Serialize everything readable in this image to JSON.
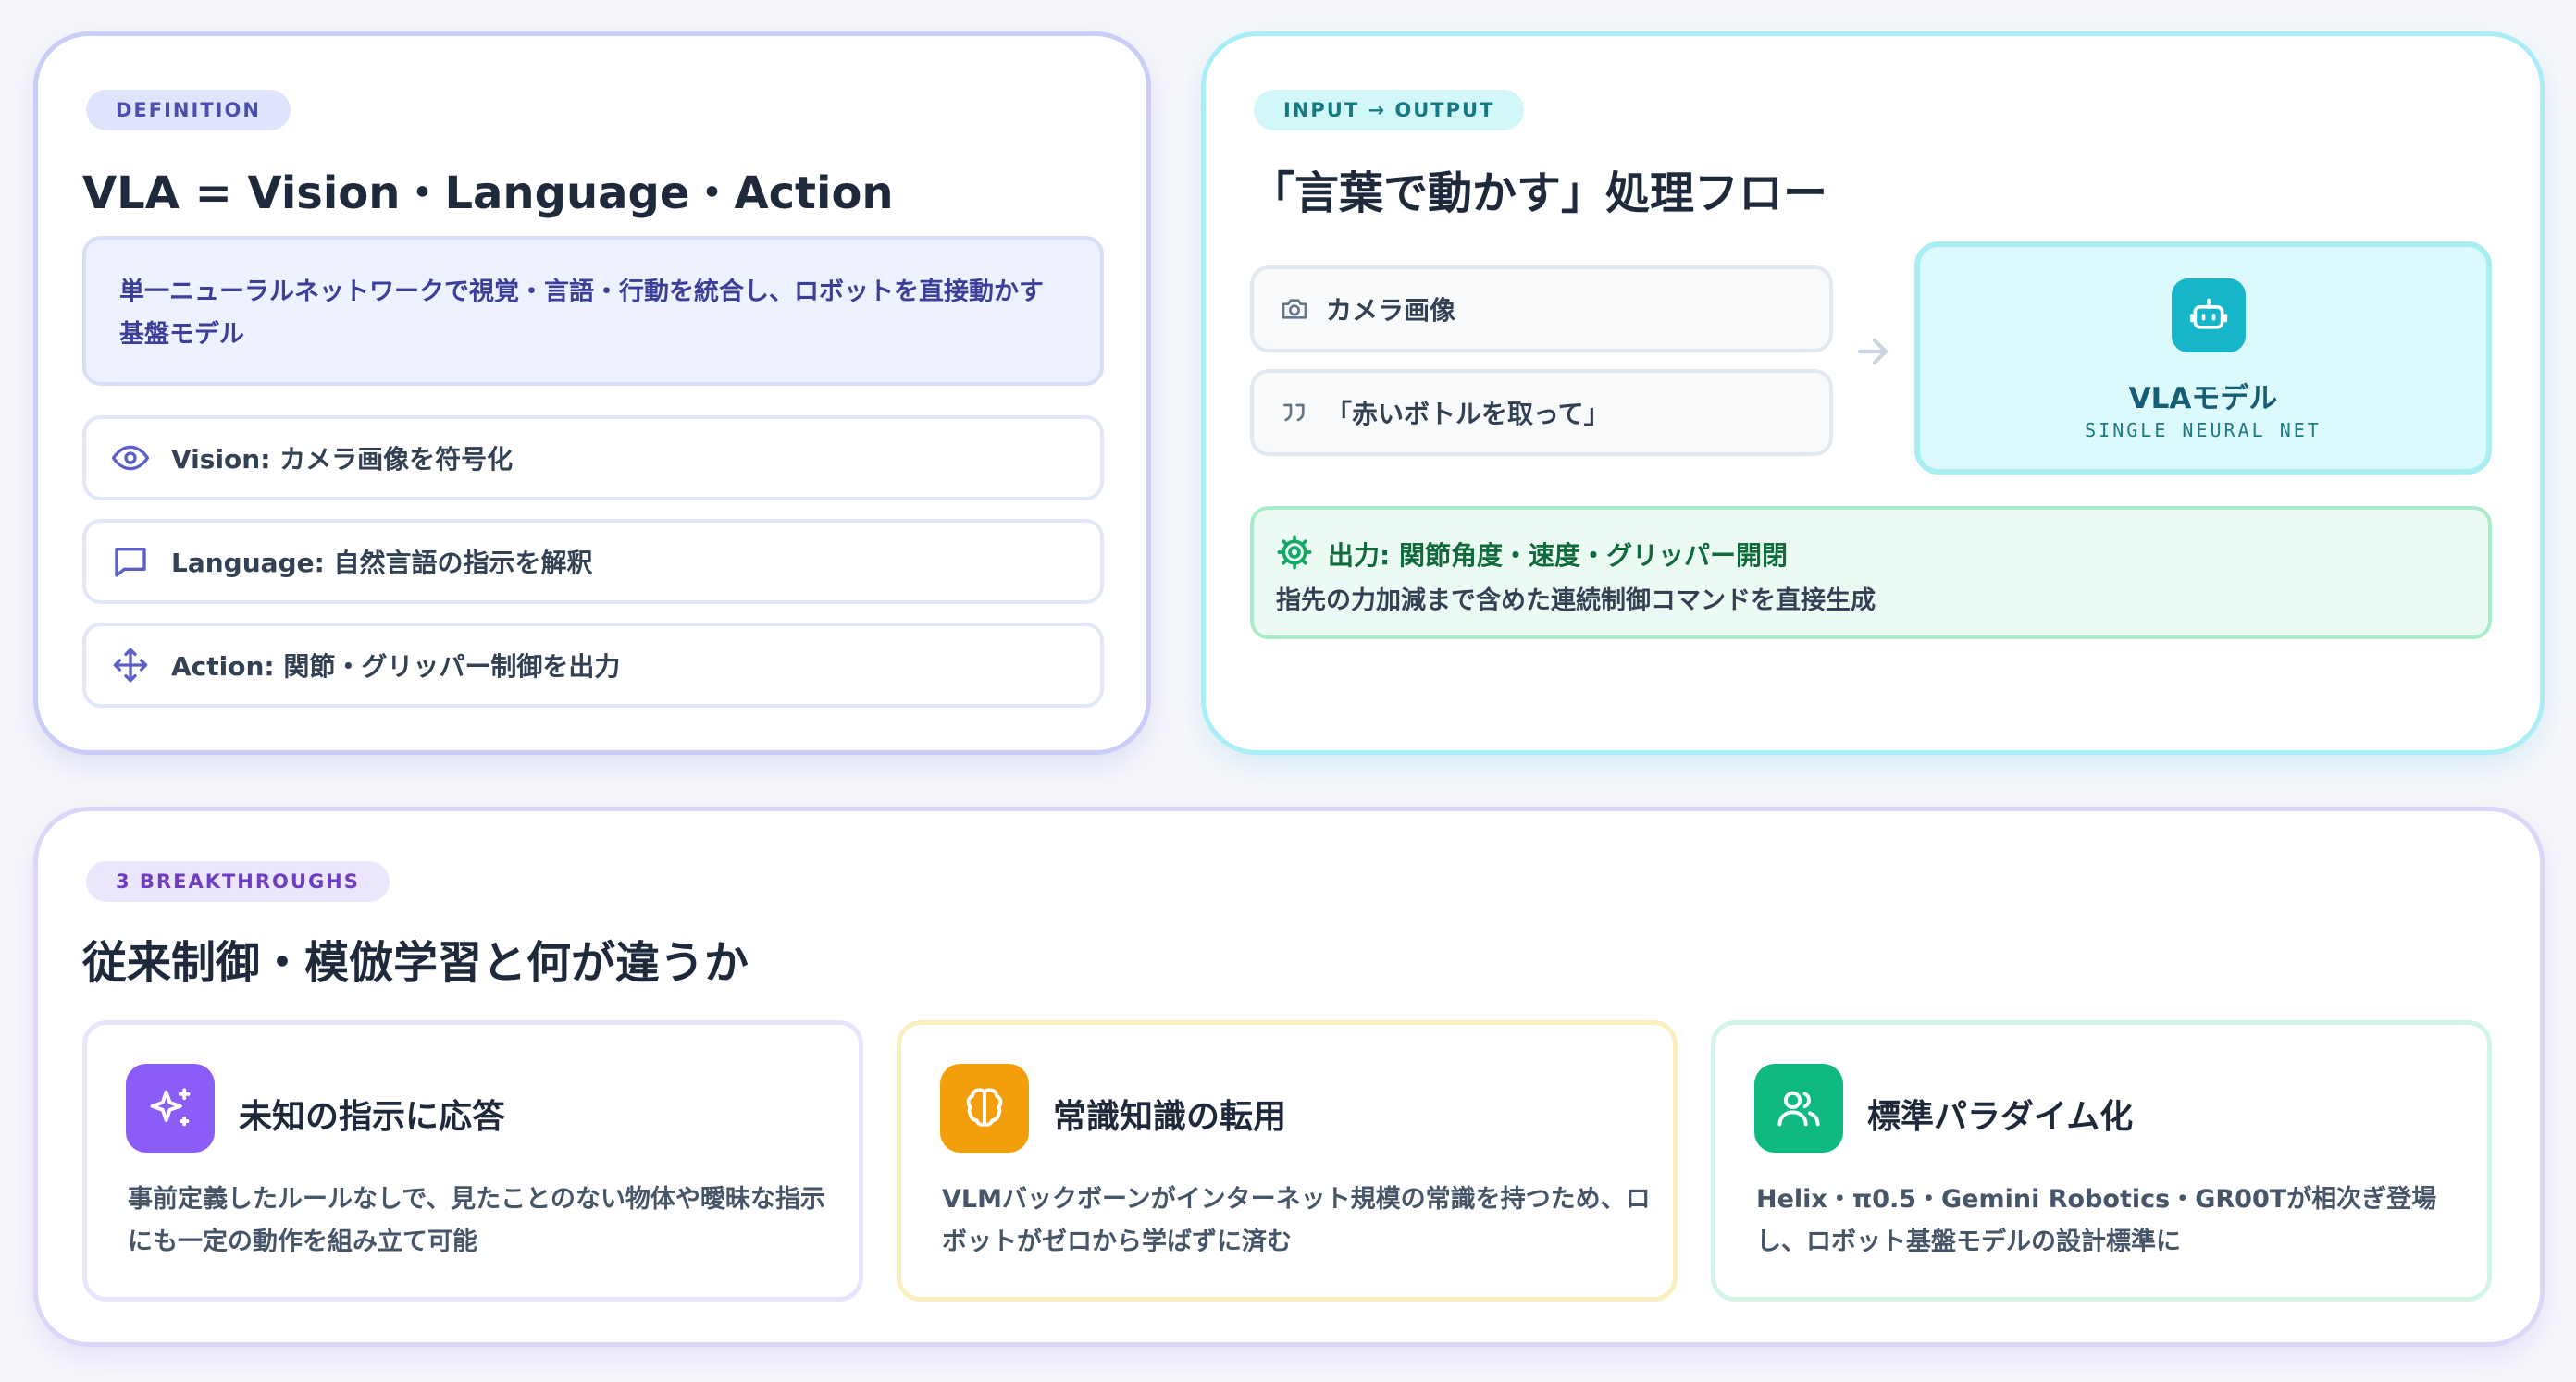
{
  "definition": {
    "tag": "DEFINITION",
    "title": "VLA = Vision・Language・Action",
    "summary": "単一ニューラルネットワークで視覚・言語・行動を統合し、ロボットを直接動かす基盤モデル",
    "items": [
      {
        "icon": "eye-icon",
        "label": "Vision: カメラ画像を符号化"
      },
      {
        "icon": "chat-bubble-icon",
        "label": "Language: 自然言語の指示を解釈"
      },
      {
        "icon": "move-arrows-icon",
        "label": "Action: 関節・グリッパー制御を出力"
      }
    ]
  },
  "flow": {
    "tag": "INPUT → OUTPUT",
    "title": "「言葉で動かす」処理フロー",
    "inputs": [
      {
        "icon": "camera-icon",
        "label": "カメラ画像"
      },
      {
        "icon": "quote-icon",
        "label": "「赤いボトルを取って」"
      }
    ],
    "model": {
      "name": "VLAモデル",
      "subtitle": "SINGLE NEURAL NET",
      "icon": "robot-icon"
    },
    "output": {
      "icon": "gear-icon",
      "title": "出力: 関節角度・速度・グリッパー開閉",
      "description": "指先の力加減まで含めた連続制御コマンドを直接生成"
    }
  },
  "breakthroughs": {
    "tag": "3 BREAKTHROUGHS",
    "title": "従来制御・模倣学習と何が違うか",
    "items": [
      {
        "icon": "sparkles-icon",
        "color": "#8b5cf6",
        "title": "未知の指示に応答",
        "description": "事前定義したルールなしで、見たことのない物体や曖昧な指示にも一定の動作を組み立て可能"
      },
      {
        "icon": "brain-icon",
        "color": "#f59e0b",
        "title": "常識知識の転用",
        "description": "VLMバックボーンがインターネット規模の常識を持つため、ロボットがゼロから学ばずに済む"
      },
      {
        "icon": "users-icon",
        "color": "#10b981",
        "title": "標準パラダイム化",
        "description": "Helix・π0.5・Gemini Robotics・GR00Tが相次ぎ登場し、ロボット基盤モデルの設計標準に"
      }
    ]
  }
}
